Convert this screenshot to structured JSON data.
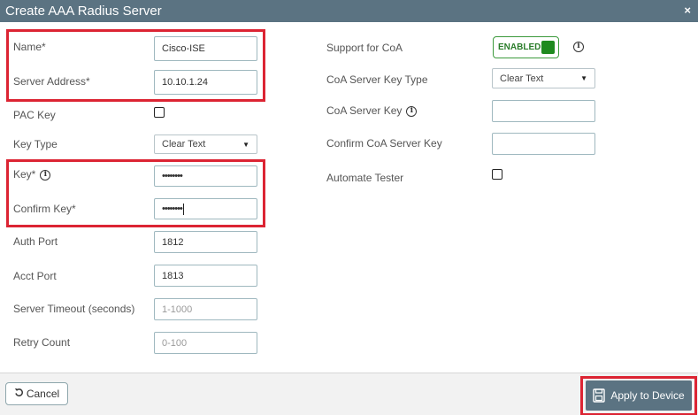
{
  "dialog": {
    "title": "Create AAA Radius Server",
    "close_glyph": "×"
  },
  "form": {
    "name": {
      "label": "Name*",
      "value": "Cisco-ISE"
    },
    "server_address": {
      "label": "Server Address*",
      "value": "10.10.1.24"
    },
    "pac_key": {
      "label": "PAC Key",
      "checked": false
    },
    "key_type": {
      "label": "Key Type",
      "selected": "Clear Text"
    },
    "key": {
      "label": "Key*",
      "value": "••••••••"
    },
    "confirm_key": {
      "label": "Confirm Key*",
      "value": "••••••••"
    },
    "auth_port": {
      "label": "Auth Port",
      "value": "1812"
    },
    "acct_port": {
      "label": "Acct Port",
      "value": "1813"
    },
    "server_timeout": {
      "label": "Server Timeout (seconds)",
      "placeholder": "1-1000"
    },
    "retry_count": {
      "label": "Retry Count",
      "placeholder": "0-100"
    }
  },
  "coa": {
    "support": {
      "label": "Support for CoA",
      "toggle_text": "ENABLED",
      "enabled": true
    },
    "key_type": {
      "label": "CoA Server Key Type",
      "selected": "Clear Text"
    },
    "server_key": {
      "label": "CoA Server Key",
      "value": ""
    },
    "confirm_key": {
      "label": "Confirm CoA Server Key",
      "value": ""
    },
    "automate_tester": {
      "label": "Automate Tester",
      "checked": false
    }
  },
  "footer": {
    "cancel_label": "Cancel",
    "apply_label": "Apply to Device"
  },
  "colors": {
    "header": "#5b7382",
    "highlight": "#dc2433",
    "enabled_green": "#1e8a1e"
  },
  "icons": {
    "info": "info-icon",
    "cancel": "undo-icon",
    "apply": "save-document-icon",
    "close": "close-icon"
  }
}
